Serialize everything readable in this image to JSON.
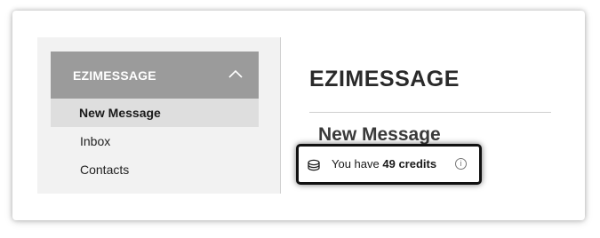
{
  "sidebar": {
    "header": {
      "title": "EZIMESSAGE",
      "icon": "chevron-up-icon"
    },
    "items": [
      {
        "label": "New Message",
        "active": true
      },
      {
        "label": "Inbox",
        "active": false
      },
      {
        "label": "Contacts",
        "active": false
      }
    ]
  },
  "main": {
    "app_title": "EZIMESSAGE",
    "section_title": "New Message",
    "credits": {
      "prefix": "You have",
      "amount": "49 credits",
      "coin_icon": "coins-icon",
      "info_icon": "info-icon",
      "info_glyph": "i"
    }
  },
  "colors": {
    "sidebar_bg": "#f2f2f2",
    "sidebar_header_bg": "#9b9b9b",
    "active_item_bg": "#dedede",
    "highlight_border": "#111111"
  }
}
